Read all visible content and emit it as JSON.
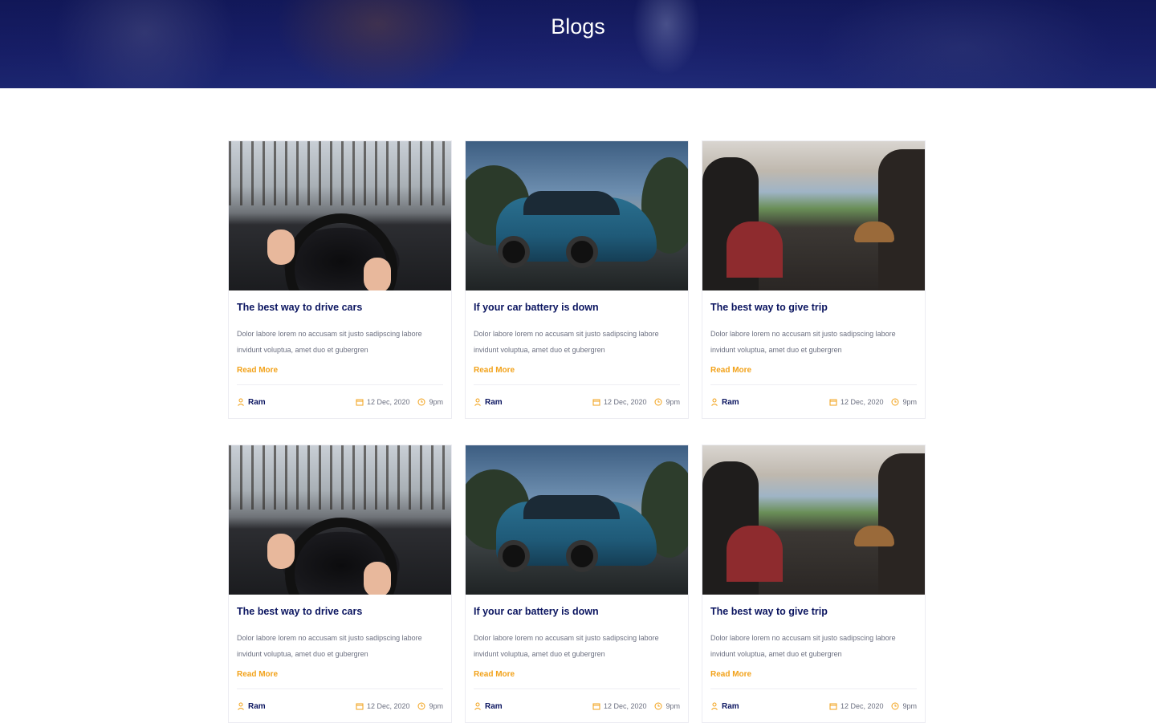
{
  "page": {
    "title": "Blogs"
  },
  "colors": {
    "accent": "#f2a21a",
    "heading": "#0b1560",
    "text": "#6b6f80",
    "hero": "#1c2370"
  },
  "icons": {
    "author": "user-icon",
    "date": "calendar-icon",
    "time": "clock-icon"
  },
  "posts": [
    {
      "image": "snow-driving",
      "title": "The best way to drive cars",
      "desc": "Dolor labore lorem no accusam sit justo sadipscing labore invidunt voluptua, amet duo et gubergren",
      "cta": "Read More",
      "author": "Ram",
      "date": "12 Dec, 2020",
      "time": "9pm"
    },
    {
      "image": "blue-car",
      "title": "If your car battery is down",
      "desc": "Dolor labore lorem no accusam sit justo sadipscing labore invidunt voluptua, amet duo et gubergren",
      "cta": "Read More",
      "author": "Ram",
      "date": "12 Dec, 2020",
      "time": "9pm"
    },
    {
      "image": "road-trip",
      "title": "The best way to give trip",
      "desc": "Dolor labore lorem no accusam sit justo sadipscing labore invidunt voluptua, amet duo et gubergren",
      "cta": "Read More",
      "author": "Ram",
      "date": "12 Dec, 2020",
      "time": "9pm"
    },
    {
      "image": "snow-driving",
      "title": "The best way to drive cars",
      "desc": "Dolor labore lorem no accusam sit justo sadipscing labore invidunt voluptua, amet duo et gubergren",
      "cta": "Read More",
      "author": "Ram",
      "date": "12 Dec, 2020",
      "time": "9pm"
    },
    {
      "image": "blue-car",
      "title": "If your car battery is down",
      "desc": "Dolor labore lorem no accusam sit justo sadipscing labore invidunt voluptua, amet duo et gubergren",
      "cta": "Read More",
      "author": "Ram",
      "date": "12 Dec, 2020",
      "time": "9pm"
    },
    {
      "image": "road-trip",
      "title": "The best way to give trip",
      "desc": "Dolor labore lorem no accusam sit justo sadipscing labore invidunt voluptua, amet duo et gubergren",
      "cta": "Read More",
      "author": "Ram",
      "date": "12 Dec, 2020",
      "time": "9pm"
    }
  ]
}
